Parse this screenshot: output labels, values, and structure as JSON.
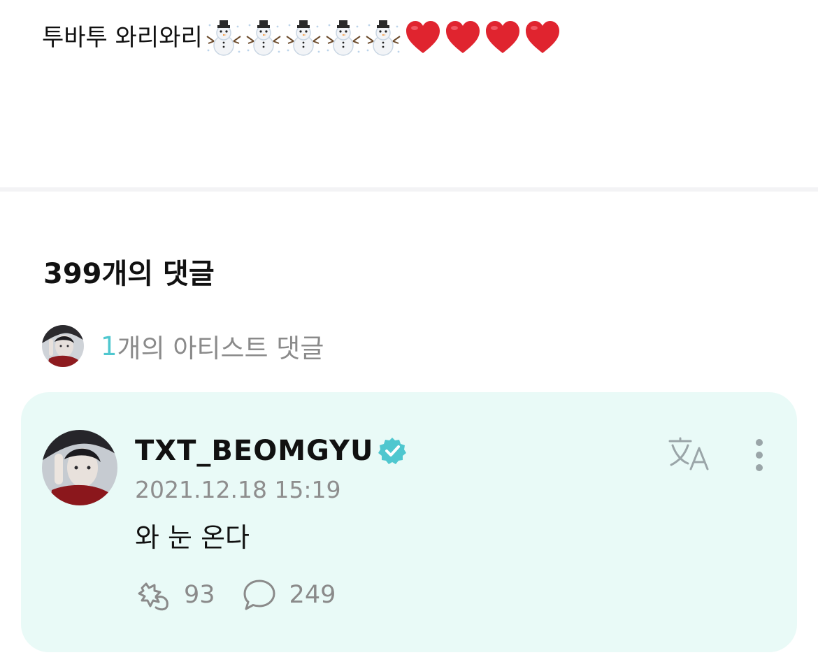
{
  "post": {
    "text": "투바투 와리와리",
    "emojis": [
      "snowman-icon",
      "snowman-icon",
      "snowman-icon",
      "snowman-icon",
      "snowman-icon",
      "heart-icon",
      "heart-icon",
      "heart-icon",
      "heart-icon"
    ]
  },
  "comments": {
    "count_label": "399개의 댓글",
    "artist_count": "1",
    "artist_label": "개의 아티스트 댓글"
  },
  "comment": {
    "username": "TXT_BEOMGYU",
    "timestamp": "2021.12.18 15:19",
    "text": "와 눈 온다",
    "likes": "93",
    "replies": "249"
  },
  "colors": {
    "accent": "#4fc7cf",
    "card_bg": "#e9faf7",
    "muted": "#8a8a8a",
    "heart": "#e0242f"
  }
}
